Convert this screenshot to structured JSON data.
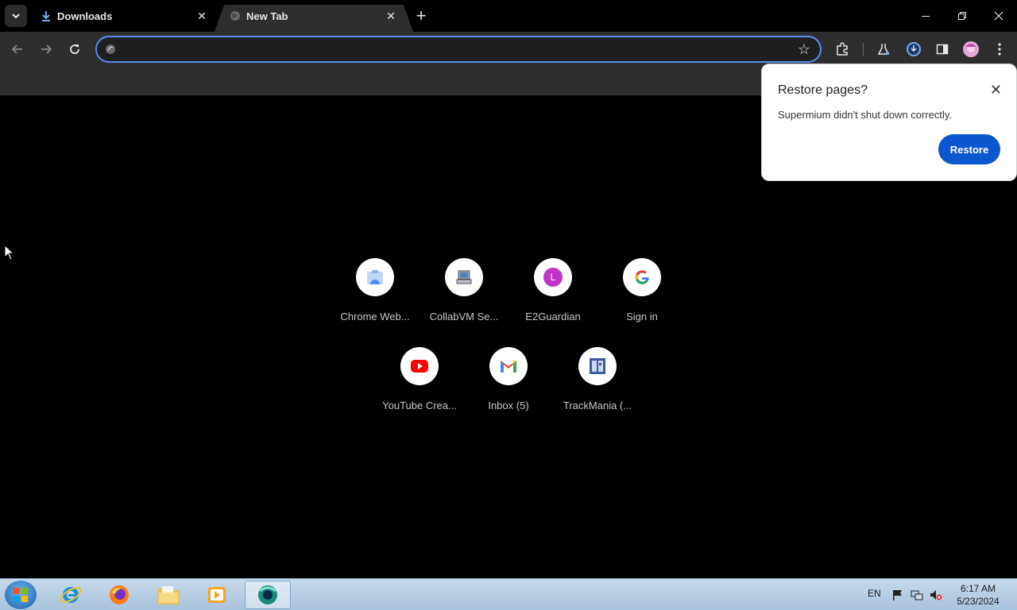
{
  "tabs": [
    {
      "title": "Downloads",
      "icon": "download-icon"
    },
    {
      "title": "New Tab",
      "icon": "globe-icon"
    }
  ],
  "omnibox": {
    "value": "",
    "placeholder": ""
  },
  "shortcuts": [
    {
      "label": "Chrome Web...",
      "icon": "chrome-web-store-icon"
    },
    {
      "label": "CollabVM Se...",
      "icon": "collabvm-icon"
    },
    {
      "label": "E2Guardian",
      "icon": "letter-l-icon",
      "letter": "L",
      "letter_color": "#c234c9"
    },
    {
      "label": "Sign in",
      "icon": "google-icon",
      "letter": "G"
    },
    {
      "label": "YouTube Crea...",
      "icon": "youtube-icon"
    },
    {
      "label": "Inbox (5)",
      "icon": "gmail-icon",
      "letter": "M"
    },
    {
      "label": "TrackMania (...",
      "icon": "trackmania-icon"
    }
  ],
  "restore_bubble": {
    "title": "Restore pages?",
    "message": "Supermium didn't shut down correctly.",
    "button": "Restore",
    "button_color": "#0b57d0"
  },
  "taskbar": {
    "language": "EN",
    "time": "6:17 AM",
    "date": "5/23/2024",
    "apps": [
      "internet-explorer-icon",
      "firefox-icon",
      "file-explorer-icon",
      "media-player-icon",
      "supermium-icon"
    ]
  }
}
